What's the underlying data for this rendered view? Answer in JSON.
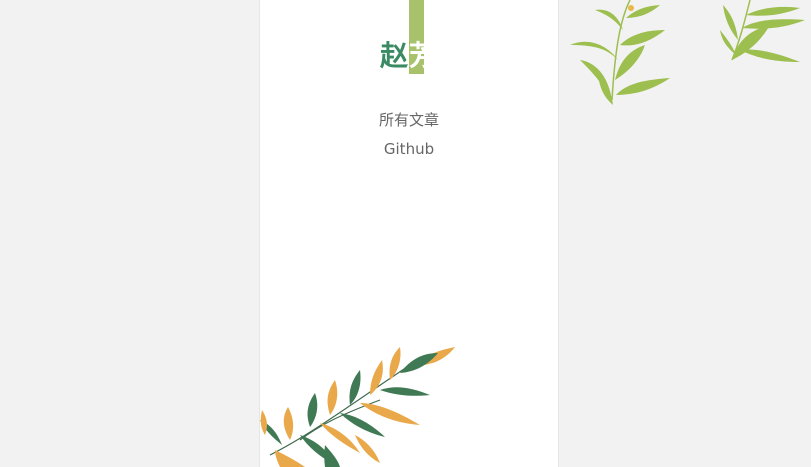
{
  "brand": {
    "first_char": "赵",
    "second_char": "芳",
    "accent_color": "#a7c26a",
    "text_color": "#3a8a63"
  },
  "nav": {
    "items": [
      {
        "label": "所有文章"
      },
      {
        "label": "Github"
      }
    ]
  },
  "decorations": {
    "top_right": "bamboo-leaves-illustration",
    "bottom_left": "bamboo-branch-illustration"
  }
}
